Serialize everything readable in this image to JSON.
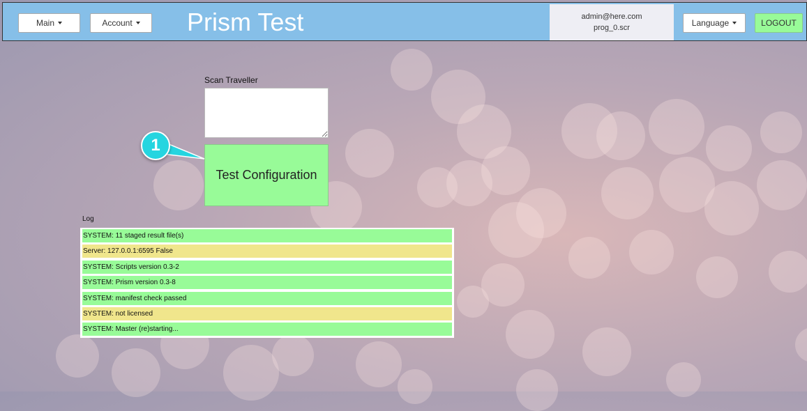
{
  "navbar": {
    "main_label": "Main",
    "account_label": "Account",
    "title": "Prism Test",
    "user_email": "admin@here.com",
    "program_file": "prog_0.scr",
    "language_label": "Language",
    "logout_label": "LOGOUT"
  },
  "scan": {
    "label": "Scan Traveller",
    "value": ""
  },
  "test_button": {
    "label": "Test Configuration"
  },
  "callout": {
    "number": "1"
  },
  "log": {
    "label": "Log",
    "entries": [
      {
        "text": "SYSTEM: 11 staged result file(s)",
        "status": "ok"
      },
      {
        "text": "Server: 127.0.0.1:6595 False",
        "status": "warn"
      },
      {
        "text": "SYSTEM: Scripts version 0.3-2",
        "status": "ok"
      },
      {
        "text": "SYSTEM: Prism version 0.3-8",
        "status": "ok"
      },
      {
        "text": "SYSTEM: manifest check passed",
        "status": "ok"
      },
      {
        "text": "SYSTEM: not licensed",
        "status": "warn"
      },
      {
        "text": "SYSTEM: Master (re)starting...",
        "status": "ok"
      }
    ]
  },
  "colors": {
    "navbar": "#86bfe8",
    "ok": "#98fb98",
    "warn": "#f0e68c",
    "callout": "#25d5e0"
  }
}
